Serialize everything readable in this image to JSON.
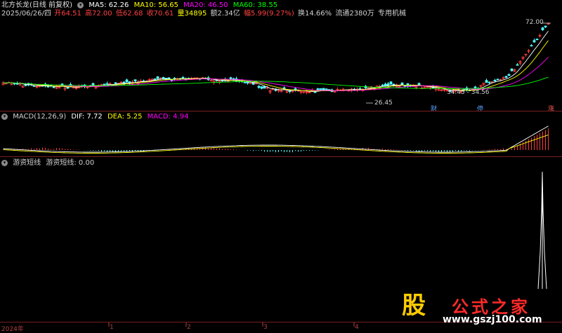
{
  "header": {
    "stock_name": "北方长龙(日线 前复权)",
    "ma5": "MA5: 62.26",
    "ma10": "MA10: 56.65",
    "ma20": "MA20: 46.50",
    "ma60": "MA60: 38.55"
  },
  "quote": {
    "date": "2025/06/26/四",
    "open": "开64.51",
    "high": "高72.00",
    "low": "低62.68",
    "close": "收70.61",
    "volume": "量34895",
    "amount": "额2.34亿",
    "change": "幅5.99(9.27%)",
    "turnover": "换14.66%",
    "float": "流通2380万",
    "industry": "专用机械"
  },
  "price_annotations": {
    "high_label": "72.00",
    "low_label": "26.45",
    "range_label": "34.45 - 34.56"
  },
  "markers": [
    {
      "text": "财",
      "type": "info"
    },
    {
      "text": "停",
      "type": "info"
    },
    {
      "text": "涨",
      "type": "up"
    }
  ],
  "macd": {
    "title": "MACD(12,26,9)",
    "dif": "DIF: 7.72",
    "dea": "DEA: 5.25",
    "macd": "MACD: 4.94"
  },
  "youzi": {
    "title": "游资短线",
    "label": "游资短线: 0.00"
  },
  "time_axis": [
    "2024年",
    "1",
    "2",
    "3",
    "4"
  ],
  "watermark": {
    "logo": "股",
    "title": "公式之家",
    "url": "www.gszj100.com"
  },
  "colors": {
    "background": "#000000",
    "up": "#ff3c3c",
    "down": "#54ffff",
    "ma5": "#ffffff",
    "ma10": "#ffff00",
    "ma20": "#ff00ff",
    "ma60": "#00ff00",
    "separator": "#7a1f1f"
  }
}
